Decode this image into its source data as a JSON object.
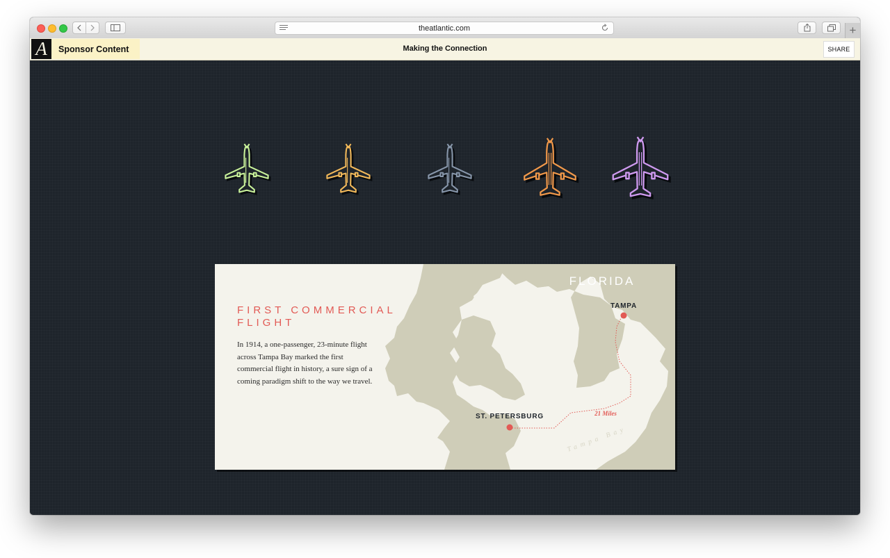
{
  "browser": {
    "url": "theatlantic.com"
  },
  "sponsor_bar": {
    "logo_letter": "A",
    "sponsor_label": "Sponsor Content",
    "page_title": "Making the Connection",
    "share_label": "SHARE"
  },
  "planes": [
    {
      "color": "#c9f29a"
    },
    {
      "color": "#f2b95a"
    },
    {
      "color": "#8796aa"
    },
    {
      "color": "#f2994a"
    },
    {
      "color": "#cf9af0"
    }
  ],
  "map_card": {
    "title": "First Commercial Flight",
    "body": "In 1914, a one-passenger, 23-minute flight across Tampa Bay marked the first commercial flight in history, a sure sign of a coming paradigm shift to the way we travel.",
    "region_label": "FLORIDA",
    "city_a": "TAMPA",
    "city_b": "ST. PETERSBURG",
    "distance": "21 Miles",
    "water_label": "Tampa Bay",
    "colors": {
      "land": "#cfcdb8",
      "water": "#f4f3ec",
      "accent": "#e25a55"
    }
  }
}
